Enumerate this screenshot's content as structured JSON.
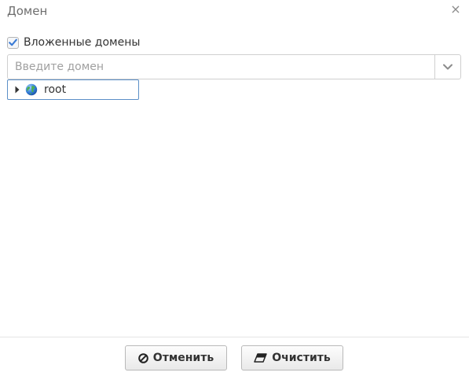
{
  "dialog": {
    "title": "Домен",
    "close_glyph": "×"
  },
  "include_subdomains": {
    "label": "Вложенные домены",
    "checked": true
  },
  "domain_search": {
    "value": "",
    "placeholder": "Введите домен",
    "toggle_icon": "chevron-down-icon"
  },
  "tree": {
    "nodes": [
      {
        "label": "root",
        "icon": "globe-icon",
        "expanded": false
      }
    ]
  },
  "buttons": {
    "cancel_label": "Отменить",
    "cancel_icon": "ban-icon",
    "clear_label": "Очистить",
    "clear_icon": "eraser-icon"
  },
  "colors": {
    "accent_border": "#5b8fc7",
    "checkbox_check": "#3a7bd5"
  }
}
